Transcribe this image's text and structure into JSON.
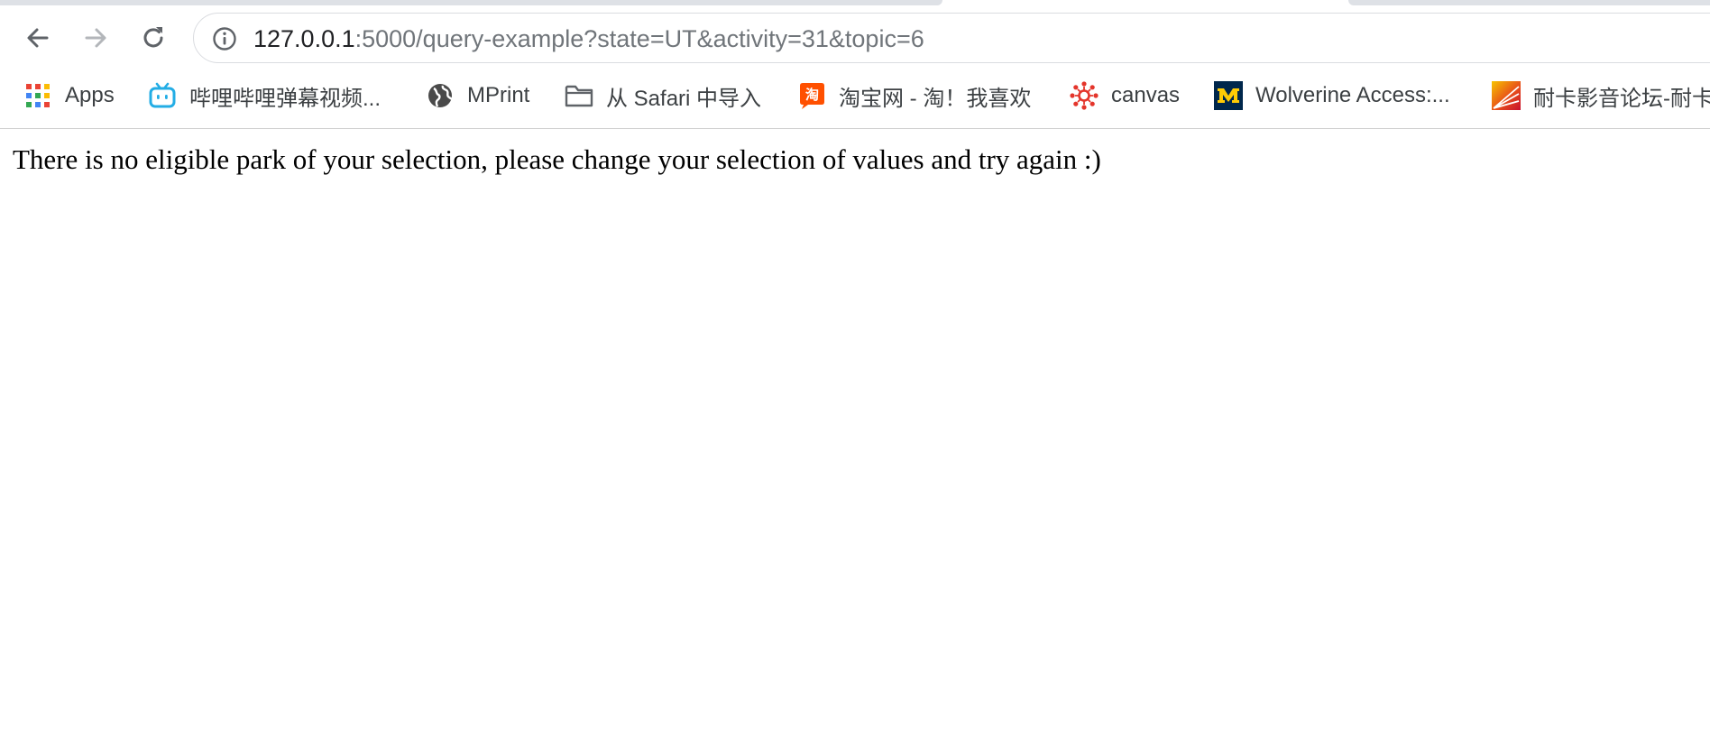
{
  "browser": {
    "url_host": "127.0.0.1",
    "url_rest": ":5000/query-example?state=UT&activity=31&topic=6",
    "icons": {
      "back": "arrow-left-icon",
      "forward": "arrow-right-icon",
      "reload": "reload-icon",
      "site_info": "info-icon"
    }
  },
  "bookmarks": [
    {
      "label": "Apps",
      "icon": "apps-grid-icon"
    },
    {
      "label": "哔哩哔哩弹幕视频...",
      "icon": "bilibili-tv-icon"
    },
    {
      "label": "MPrint",
      "icon": "globe-icon"
    },
    {
      "label": "从 Safari 中导入",
      "icon": "folder-icon"
    },
    {
      "label": "淘宝网 - 淘！我喜欢",
      "icon": "taobao-icon"
    },
    {
      "label": "canvas",
      "icon": "canvas-icon"
    },
    {
      "label": "Wolverine Access:...",
      "icon": "michigan-m-icon"
    },
    {
      "label": "耐卡影音论坛-耐卡",
      "icon": "naika-icon"
    }
  ],
  "page": {
    "message": "There is no eligible park of your selection, please change your selection of values and try again :)"
  }
}
